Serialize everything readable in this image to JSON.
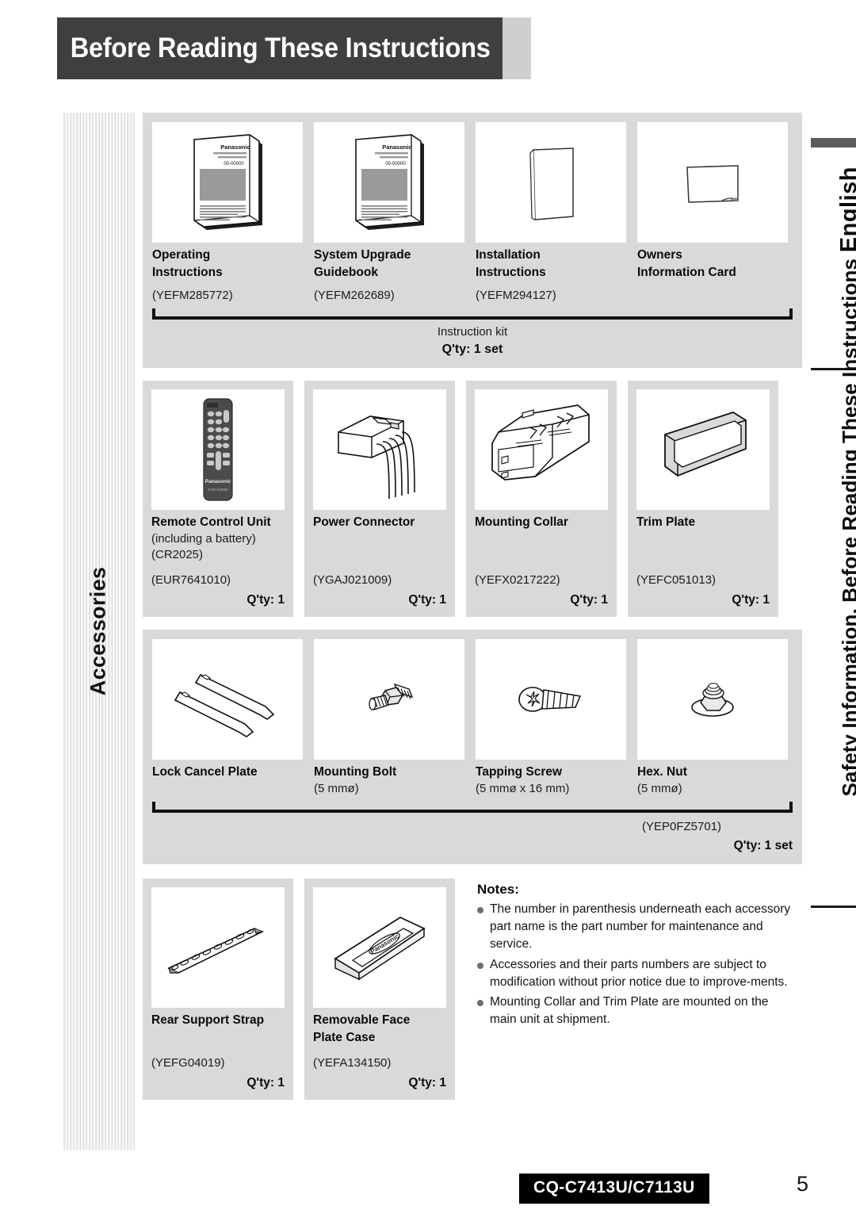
{
  "header": {
    "title": "Before Reading These Instructions"
  },
  "rails": {
    "left_label": "Accessories",
    "right_label_top": "English",
    "right_label_bottom": "Safety Information, Before Reading These Instructions"
  },
  "instruction_kit": {
    "items": [
      {
        "name": "Operating\nInstructions",
        "name_line1": "Operating",
        "name_line2": "Instructions",
        "part": "(YEFM285772)",
        "icon": "manual-book-icon"
      },
      {
        "name_line1": "System Upgrade",
        "name_line2": "Guidebook",
        "part": "(YEFM262689)",
        "icon": "manual-book-icon"
      },
      {
        "name_line1": "Installation",
        "name_line2": "Instructions",
        "part": "(YEFM294127)",
        "icon": "sheet-portrait-icon"
      },
      {
        "name_line1": "Owners",
        "name_line2": "Information Card",
        "part": "",
        "icon": "card-landscape-icon"
      }
    ],
    "group_caption": "Instruction kit",
    "group_qty": "Q'ty: 1 set"
  },
  "parts_row": {
    "items": [
      {
        "name": "Remote Control Unit",
        "sub1": "(including a battery)",
        "sub2": "(CR2025)",
        "part": "(EUR7641010)",
        "qty": "Q'ty: 1",
        "icon": "remote-control-icon"
      },
      {
        "name": "Power Connector",
        "sub1": "",
        "sub2": "",
        "part": "(YGAJ021009)",
        "qty": "Q'ty: 1",
        "icon": "power-connector-icon"
      },
      {
        "name": "Mounting Collar",
        "sub1": "",
        "sub2": "",
        "part": "(YEFX0217222)",
        "qty": "Q'ty: 1",
        "icon": "mounting-collar-icon"
      },
      {
        "name": "Trim Plate",
        "sub1": "",
        "sub2": "",
        "part": "(YEFC051013)",
        "qty": "Q'ty: 1",
        "icon": "trim-plate-icon"
      }
    ]
  },
  "hardware_row": {
    "items": [
      {
        "name": "Lock Cancel Plate",
        "sub": "",
        "icon": "lock-cancel-plate-icon"
      },
      {
        "name": "Mounting Bolt",
        "sub": "(5 mmø)",
        "icon": "mounting-bolt-icon"
      },
      {
        "name": "Tapping Screw",
        "sub": "(5 mmø x 16 mm)",
        "icon": "tapping-screw-icon"
      },
      {
        "name": "Hex. Nut",
        "sub": "(5 mmø)",
        "icon": "hex-nut-icon"
      }
    ],
    "group_part": "(YEP0FZ5701)",
    "group_qty": "Q'ty: 1 set"
  },
  "bottom_row": {
    "items": [
      {
        "name_line1": "Rear Support Strap",
        "name_line2": "",
        "part": "(YEFG04019)",
        "qty": "Q'ty: 1",
        "icon": "rear-support-strap-icon"
      },
      {
        "name_line1": "Removable Face",
        "name_line2": "Plate Case",
        "part": "(YEFA134150)",
        "qty": "Q'ty: 1",
        "icon": "face-plate-case-icon"
      }
    ]
  },
  "notes": {
    "title": "Notes:",
    "items": [
      "The number in parenthesis underneath each accessory part name is the part number for maintenance and service.",
      "Accessories and their parts numbers are subject to modification without prior notice due to improve-ments.",
      "Mounting Collar and Trim Plate are mounted on the main unit at shipment."
    ]
  },
  "footer": {
    "model": "CQ-C7413U/C7113U",
    "page": "5"
  },
  "colors": {
    "header_bg": "#3f3f3f",
    "panel_bg": "#d9d9d9",
    "footer_bg": "#000000"
  }
}
